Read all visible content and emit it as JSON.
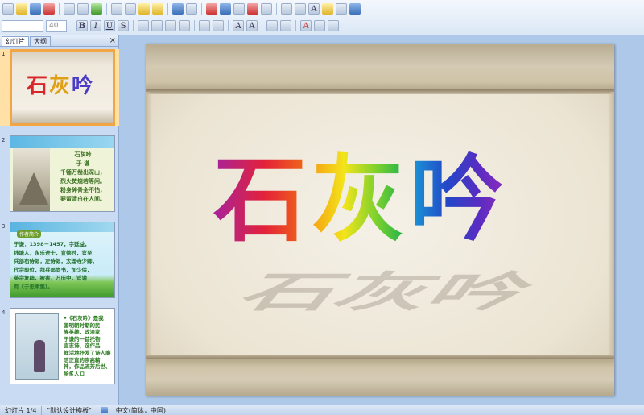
{
  "toolbar": {
    "font_name": "",
    "font_size": "40"
  },
  "pane": {
    "tabs": [
      {
        "label": "幻灯片"
      },
      {
        "label": "大纲"
      }
    ],
    "close_label": "×"
  },
  "thumbnails": [
    {
      "number": "1",
      "title_chars": [
        "石",
        "灰",
        "吟"
      ]
    },
    {
      "number": "2",
      "badge": "",
      "lines": [
        "石灰吟",
        "于 谦",
        "千锤万凿出深山，",
        "烈火焚烧若等闲。",
        "粉身碎骨全不怕，",
        "要留清白在人间。"
      ]
    },
    {
      "number": "3",
      "badge": "作者简介",
      "lines": [
        "于谦：1398－1457，字廷益，",
        "钱塘人，永乐进士，宣德时，官至",
        "兵部右侍郎，左侍郎，太理寺少卿，",
        "代宗即位，拜兵部尚书，加少保，",
        "英宗复辟，被害，万历中，追谥",
        "有《于忠肃集》。"
      ]
    },
    {
      "number": "4",
      "lines": [
        "•《石灰吟》是我",
        "国明朝时期的民",
        "族英雄、政治家",
        "于谦的一首托物",
        "言志诗，这作品",
        "鲜活地抒发了诗人廉",
        "洁正直的崇高精",
        "神，作品流芳后世、",
        "脍炙人口"
      ]
    }
  ],
  "slide": {
    "title_chars": [
      "石",
      "灰",
      "吟"
    ]
  },
  "statusbar": {
    "slide_info": "幻灯片 1/4",
    "template": "\"默认设计模板\"",
    "language": "中文(简体，中国)"
  }
}
